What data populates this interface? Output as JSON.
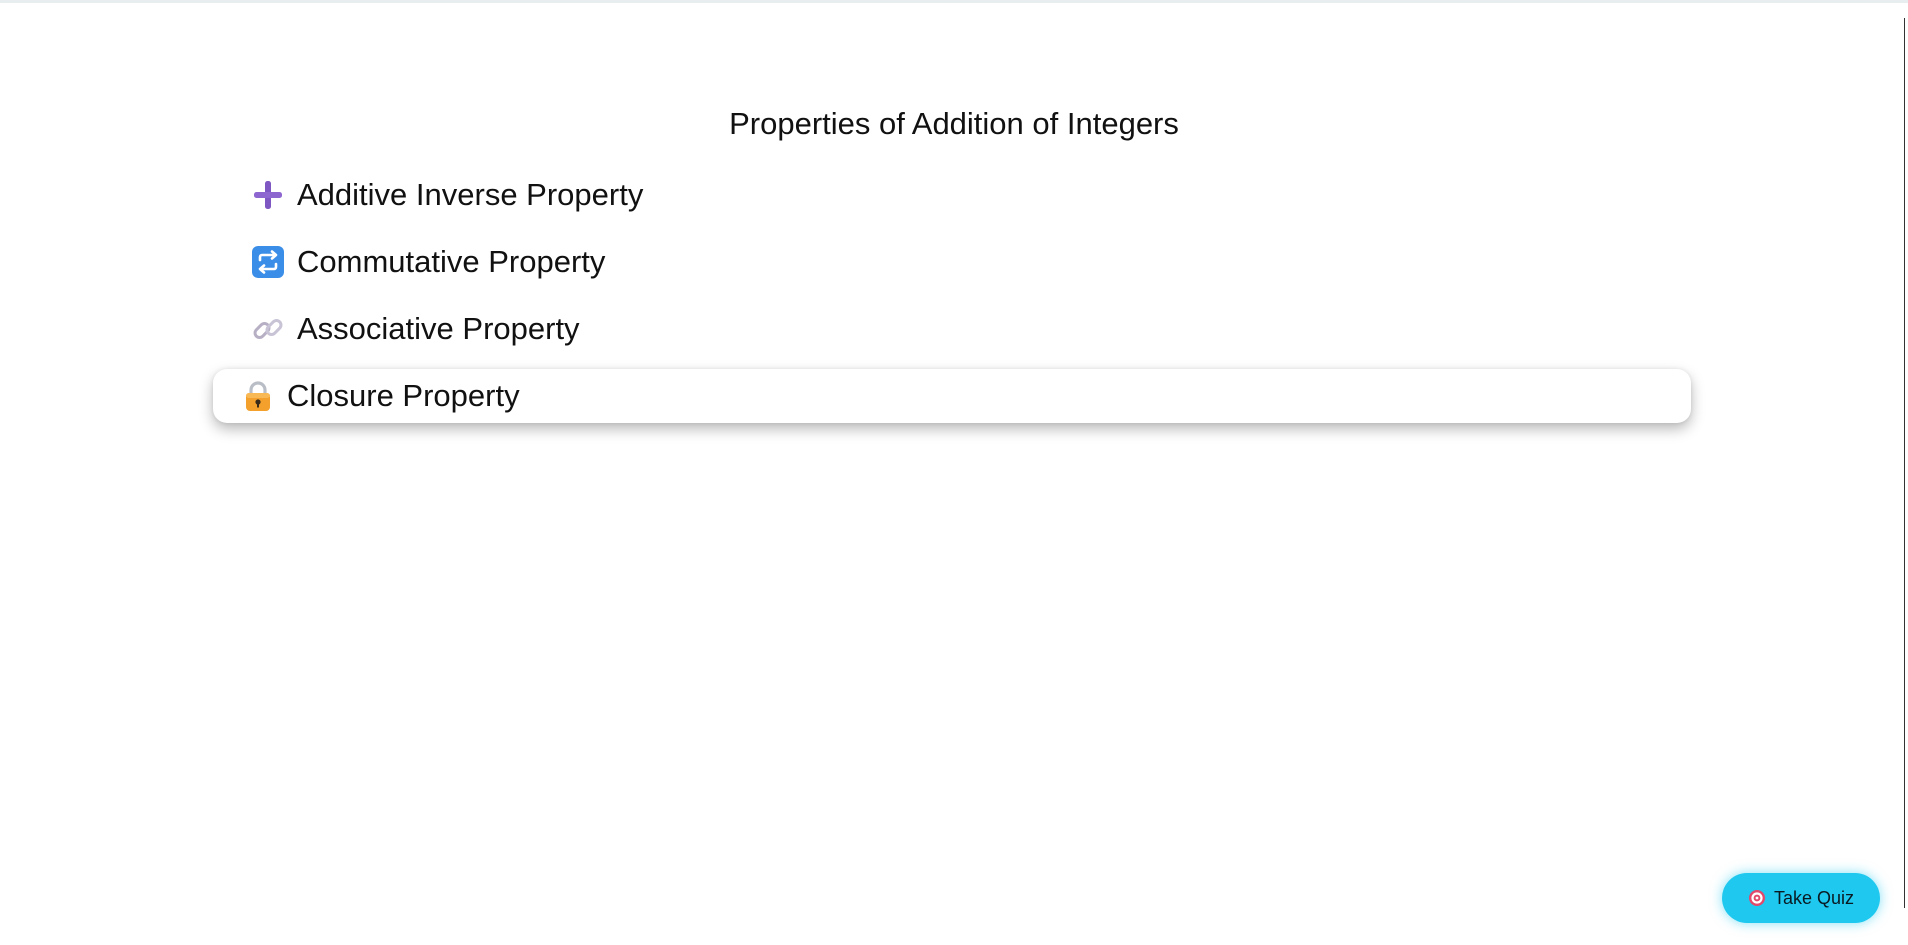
{
  "page": {
    "title": "Properties of Addition of Integers"
  },
  "properties": [
    {
      "label": "Additive Inverse Property",
      "icon": "plus-icon",
      "active": false
    },
    {
      "label": "Commutative Property",
      "icon": "repeat-icon",
      "active": false
    },
    {
      "label": "Associative Property",
      "icon": "link-icon",
      "active": false
    },
    {
      "label": "Closure Property",
      "icon": "lock-icon",
      "active": true
    }
  ],
  "quiz": {
    "label": "Take Quiz",
    "icon": "target-icon"
  },
  "colors": {
    "accent": "#1ec8ef",
    "plus": "#7e57c2",
    "repeat": "#3b8ee8",
    "lock": "#f4a02c"
  }
}
